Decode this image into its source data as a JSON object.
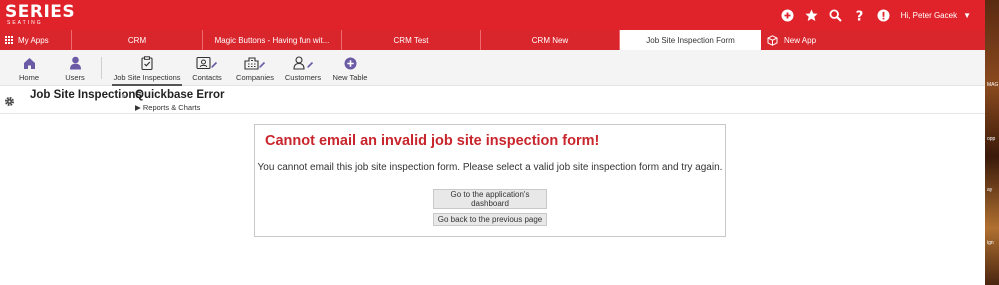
{
  "brand": {
    "name": "SERIES",
    "tagline": "SEATING"
  },
  "topbar": {
    "icons": [
      "add-icon",
      "star-icon",
      "search-icon",
      "help-icon",
      "alert-icon"
    ],
    "greeting": "Hi, Peter Gacek"
  },
  "apptabs": {
    "my_apps": "My Apps",
    "tabs": [
      {
        "label": "CRM"
      },
      {
        "label": "Magic Buttons - Having fun wit..."
      },
      {
        "label": "CRM Test"
      },
      {
        "label": "CRM New"
      },
      {
        "label": "Job Site Inspection Form"
      }
    ],
    "new_app": "New App"
  },
  "tablenav": {
    "home": "Home",
    "users": "Users",
    "job_site_inspections": "Job Site Inspections",
    "contacts": "Contacts",
    "companies": "Companies",
    "customers": "Customers",
    "new_table": "New Table"
  },
  "page": {
    "title": "Job Site Inspections",
    "subtitle": "Quickbase Error",
    "reports_link": "Reports & Charts"
  },
  "error": {
    "title": "Cannot email an invalid job site inspection form!",
    "message": "You cannot email this job site inspection form. Please select a valid job site inspection form and try again.",
    "dashboard_button": "Go to the application's dashboard",
    "back_button": "Go back to the previous page"
  },
  "background_strip": {
    "texts": [
      "MAG",
      "opp",
      "ay",
      "ign"
    ]
  },
  "colors": {
    "brand_red": "#e0232b",
    "error_red": "#c8252c"
  }
}
